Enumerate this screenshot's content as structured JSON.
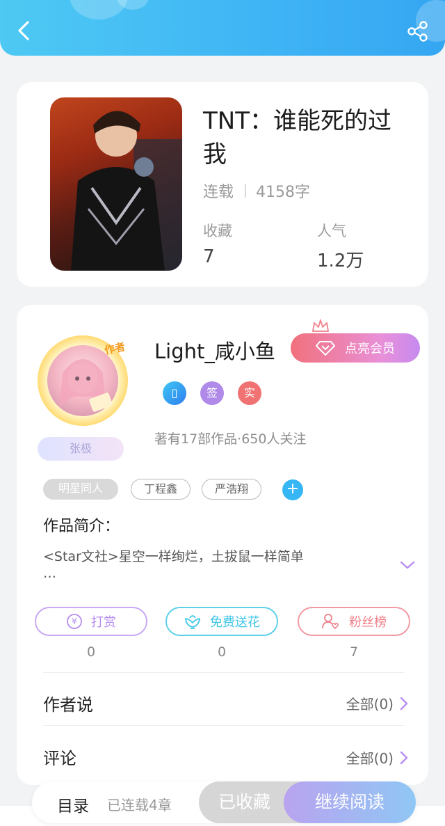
{
  "header": {
    "back_icon": "chevron-left-icon",
    "share_icon": "share-icon"
  },
  "book": {
    "title": "TNT：谁能死的过我",
    "status": "连载",
    "word_count": "4158字",
    "fav_label": "收藏",
    "fav_value": "7",
    "pop_label": "人气",
    "pop_value": "1.2万"
  },
  "author": {
    "badge": "作者",
    "title_tag": "张极",
    "name": "Light_咸小鱼",
    "vip_label": "点亮会员",
    "badges": [
      {
        "text": "▯",
        "color": "#3aa7f3"
      },
      {
        "text": "签",
        "color": "#b08ae8"
      },
      {
        "text": "实",
        "color": "#f07272"
      }
    ],
    "works_line": "著有17部作品·650人关注"
  },
  "tags": [
    "明星同人",
    "丁程鑫",
    "严浩翔"
  ],
  "intro": {
    "title": "作品简介：",
    "text": "<Star文社>星空一样绚烂，土拔鼠一样简单",
    "ellipsis": "…"
  },
  "actions": [
    {
      "label": "打赏",
      "count": "0",
      "color": "#b68ef0",
      "icon": "coin-icon"
    },
    {
      "label": "免费送花",
      "count": "0",
      "color": "#3fc6e6",
      "icon": "flower-icon"
    },
    {
      "label": "粉丝榜",
      "count": "7",
      "color": "#ef7f8a",
      "icon": "fan-icon"
    }
  ],
  "rows": [
    {
      "title": "作者说",
      "right": "全部(0)"
    },
    {
      "title": "评论",
      "right": "全部(0)"
    }
  ],
  "bottom": {
    "toc": "目录",
    "toc_count": "已连载4章",
    "fav_btn": "已收藏",
    "read_btn": "继续阅读"
  },
  "colors": {
    "accent": "#3fb4f5",
    "vip": "#f1717c",
    "purple": "#b68ef0"
  }
}
